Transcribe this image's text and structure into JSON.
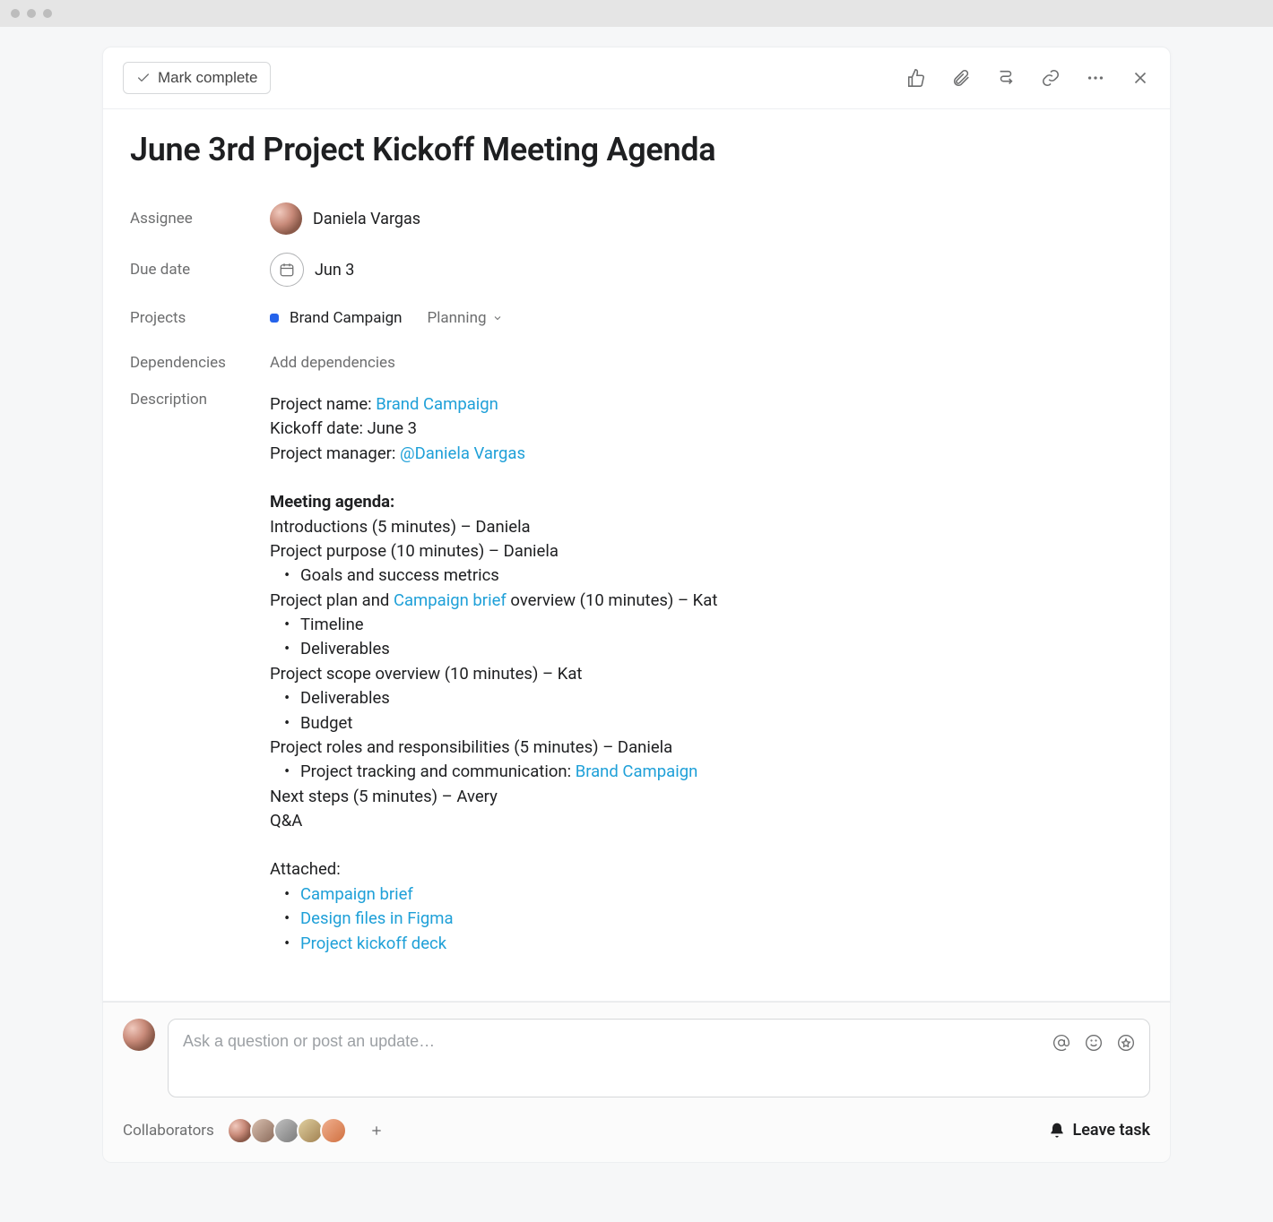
{
  "toolbar": {
    "mark_complete": "Mark complete"
  },
  "task": {
    "title": "June 3rd Project Kickoff Meeting Agenda"
  },
  "fields": {
    "assignee_label": "Assignee",
    "assignee_value": "Daniela Vargas",
    "due_label": "Due date",
    "due_value": "Jun 3",
    "projects_label": "Projects",
    "project_name": "Brand Campaign",
    "project_status": "Planning",
    "dependencies_label": "Dependencies",
    "add_dependencies": "Add dependencies",
    "description_label": "Description"
  },
  "description": {
    "l1_prefix": "Project name: ",
    "l1_link": "Brand Campaign",
    "l2": "Kickoff date: June 3",
    "l3_prefix": "Project manager: ",
    "l3_link": "@Daniela Vargas",
    "agenda_heading": "Meeting agenda:",
    "a1": "Introductions (5 minutes) – Daniela",
    "a2": "Project purpose (10 minutes) – Daniela",
    "a2_b1": "Goals and success metrics",
    "a3_prefix": "Project plan and ",
    "a3_link": "Campaign brief",
    "a3_suffix": " overview (10 minutes) – Kat",
    "a3_b1": "Timeline",
    "a3_b2": "Deliverables",
    "a4": "Project scope overview (10 minutes) – Kat",
    "a4_b1": "Deliverables",
    "a4_b2": "Budget",
    "a5": "Project roles and responsibilities (5 minutes) – Daniela",
    "a5_b1_prefix": "Project tracking and communication: ",
    "a5_b1_link": "Brand Campaign",
    "a6": "Next steps (5 minutes) – Avery",
    "a7": "Q&A",
    "attached_heading": "Attached:",
    "att1": "Campaign brief",
    "att2": "Design files in Figma",
    "att3": "Project kickoff deck"
  },
  "comment": {
    "placeholder": "Ask a question or post an update…"
  },
  "footer": {
    "collaborators_label": "Collaborators",
    "leave_task": "Leave task"
  }
}
